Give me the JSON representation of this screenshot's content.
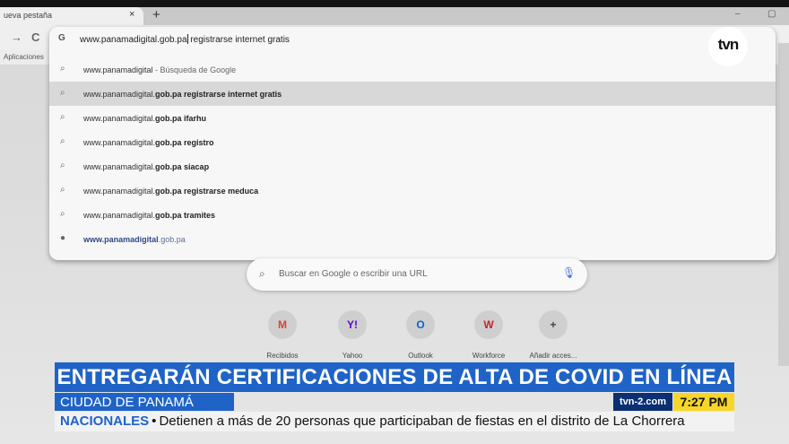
{
  "browser": {
    "tab_title": "ueva pestaña",
    "tab_close": "×",
    "new_tab": "+",
    "nav_back": "←",
    "nav_forward": "→",
    "reload": "C",
    "bookmarks_label": "Aplicaciones",
    "minimize": "–",
    "maximize": "▢"
  },
  "omnibox": {
    "g_glyph": "G",
    "value_before_caret": "www.panamadigital.gob.pa",
    "value_after_caret": " registrarse internet gratis",
    "suggestions": [
      {
        "prefix": "www.panamadigital",
        "bold": "",
        "rest": " - Búsqueda de Google"
      },
      {
        "prefix": "www.panamadigital.",
        "bold": "gob.pa registrarse internet gratis",
        "rest": ""
      },
      {
        "prefix": "www.panamadigital.",
        "bold": "gob.pa ifarhu",
        "rest": ""
      },
      {
        "prefix": "www.panamadigital.",
        "bold": "gob.pa registro",
        "rest": ""
      },
      {
        "prefix": "www.panamadigital.",
        "bold": "gob.pa siacap",
        "rest": ""
      },
      {
        "prefix": "www.panamadigital.",
        "bold": "gob.pa registrarse meduca",
        "rest": ""
      },
      {
        "prefix": "www.panamadigital.",
        "bold": "gob.pa tramites",
        "rest": ""
      }
    ],
    "link_suggestion": {
      "main": "www.panamadigital",
      "rest": ".gob.pa"
    }
  },
  "newtab": {
    "search_placeholder": "Buscar en Google o escribir una URL",
    "shortcuts": [
      {
        "glyph": "M",
        "label": "Recibidos",
        "color": "#d44638"
      },
      {
        "glyph": "Y!",
        "label": "Yahoo",
        "color": "#5f01d1"
      },
      {
        "glyph": "O",
        "label": "Outlook",
        "color": "#0a64c8"
      },
      {
        "glyph": "W",
        "label": "Workforce",
        "color": "#c8242b"
      },
      {
        "glyph": "+",
        "label": "Añadir acces...",
        "color": "#444444"
      }
    ]
  },
  "broadcast": {
    "logo": "tvn",
    "headline": "ENTREGARÁN CERTIFICACIONES DE ALTA DE COVID EN LÍNEA",
    "location": "CIUDAD DE PANAMÁ",
    "site": "tvn-2.com",
    "time": "7:27 PM",
    "ticker_section": "NACIONALES",
    "ticker_bullet": "•",
    "ticker_text": "Detienen a más de 20 personas que participaban de fiestas en el distrito de La Chorrera"
  },
  "colors": {
    "banner_blue": "#1f63c7",
    "site_navy": "#0b2f73",
    "clock_yellow": "#f7d629"
  }
}
